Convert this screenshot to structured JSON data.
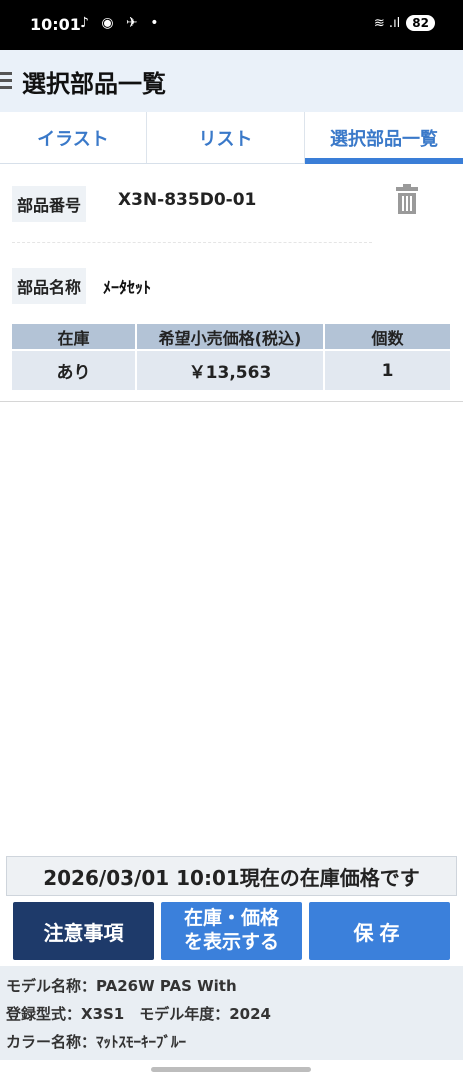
{
  "status_bar": {
    "time": "10:01",
    "battery": "82"
  },
  "header": {
    "title": "選択部品一覧"
  },
  "tabs": [
    {
      "label": "イラスト"
    },
    {
      "label": "リスト"
    },
    {
      "label": "選択部品一覧",
      "active": true
    }
  ],
  "part": {
    "number_label": "部品番号",
    "number": "X3N-835D0-01",
    "name_label": "部品名称",
    "name": "ﾒｰﾀｾｯﾄ",
    "table": {
      "headers": [
        "在庫",
        "希望小売価格(税込)",
        "個数"
      ],
      "row": [
        "あり",
        "￥13,563",
        "1"
      ]
    }
  },
  "stock_banner": "2026/03/01 10:01現在の在庫価格です",
  "buttons": {
    "caution": "注意事項",
    "show_line1": "在庫・価格",
    "show_line2": "を表示する",
    "save": "保存"
  },
  "model_info": {
    "model_name": "モデル名称：PA26W PAS With",
    "registration": "登録型式：X3S1　モデル年度：2024",
    "color": "カラー名称：ﾏｯﾄｽﾓｰｷｰﾌﾞﾙｰ"
  },
  "colors": {
    "accent": "#3b80db",
    "dark_button": "#1e3a6a",
    "table_header": "#b3c3d6"
  }
}
